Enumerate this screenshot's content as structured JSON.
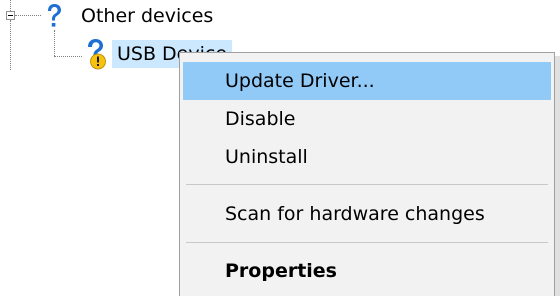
{
  "tree": {
    "category": {
      "label": "Other devices",
      "icon": "question-mark-icon",
      "expanded": true
    },
    "device": {
      "label": "USB Device",
      "icon": "unknown-device-warning-icon",
      "selected": true
    }
  },
  "context_menu": {
    "items": [
      {
        "label": "Update Driver...",
        "highlighted": true,
        "bold": false
      },
      {
        "label": "Disable",
        "highlighted": false,
        "bold": false
      },
      {
        "label": "Uninstall",
        "highlighted": false,
        "bold": false
      },
      {
        "label": "Scan for hardware changes",
        "highlighted": false,
        "bold": false
      },
      {
        "label": "Properties",
        "highlighted": false,
        "bold": true
      }
    ]
  },
  "colors": {
    "selection": "#cce8ff",
    "menu_highlight": "#91c9f7",
    "menu_background": "#f2f2f2",
    "icon_blue": "#1e6fd1",
    "warning_yellow": "#f6c20e"
  }
}
